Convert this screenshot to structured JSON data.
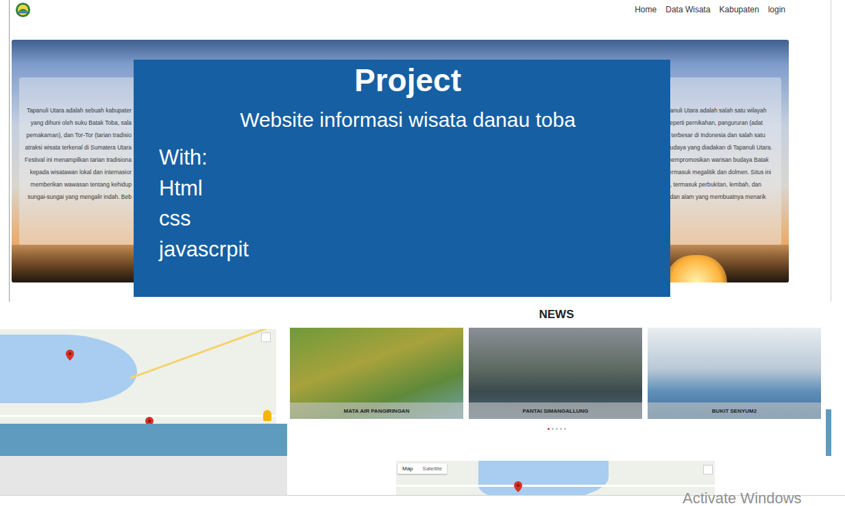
{
  "nav": {
    "links": [
      "Home",
      "Data Wisata",
      "Kabupaten",
      "login"
    ]
  },
  "hero": {
    "left_text": [
      "Tapanuli Utara adalah sebuah kabupater",
      "yang dihuni oleh suku Batak Toba, sala",
      "pemakaman), dan Tor-Tor (tarian tradisio",
      "atraksi wisata terkenal di Sumatera Utara",
      "Festival ini menampilkan tarian tradisiona",
      "kepada wisatawan lokal dan internasior",
      "memberikan wawasan tentang kehidup",
      "sungai-sungai yang mengalir indah. Beb"
    ],
    "right_text": [
      "panuli Utara adalah salah satu wilayah",
      "seperti pernikahan, pangururan (adat",
      "k terbesar di Indonesia dan salah satu",
      "budaya yang diadakan di Tapanuli Utara.",
      "mempromosikan warisan budaya Batak",
      "termasuk megalitik dan dolmen. Situs ini",
      "u, termasuk perbukitan, lembah, dan",
      ", dan alam yang membuatnya menarik"
    ]
  },
  "overlay": {
    "title": "Project",
    "subtitle": "Website informasi wisata danau toba",
    "stack_label": "With:",
    "stack": [
      "Html",
      "css",
      "javascrpit"
    ]
  },
  "news": {
    "title": "NEWS",
    "cards": [
      {
        "caption": "MATA AIR PANGIRINGAN"
      },
      {
        "caption": "PANTAI SIMANGALLUNG"
      },
      {
        "caption": "BUKIT SENYUM2"
      }
    ],
    "dots": [
      {
        "selected": true
      },
      {
        "selected": false
      },
      {
        "selected": false
      },
      {
        "selected": false
      },
      {
        "selected": false
      }
    ]
  },
  "map": {
    "controls": [
      {
        "label": "Map",
        "selected": true
      },
      {
        "label": "Satellite",
        "selected": false
      }
    ]
  },
  "watermark": "Activate Windows"
}
